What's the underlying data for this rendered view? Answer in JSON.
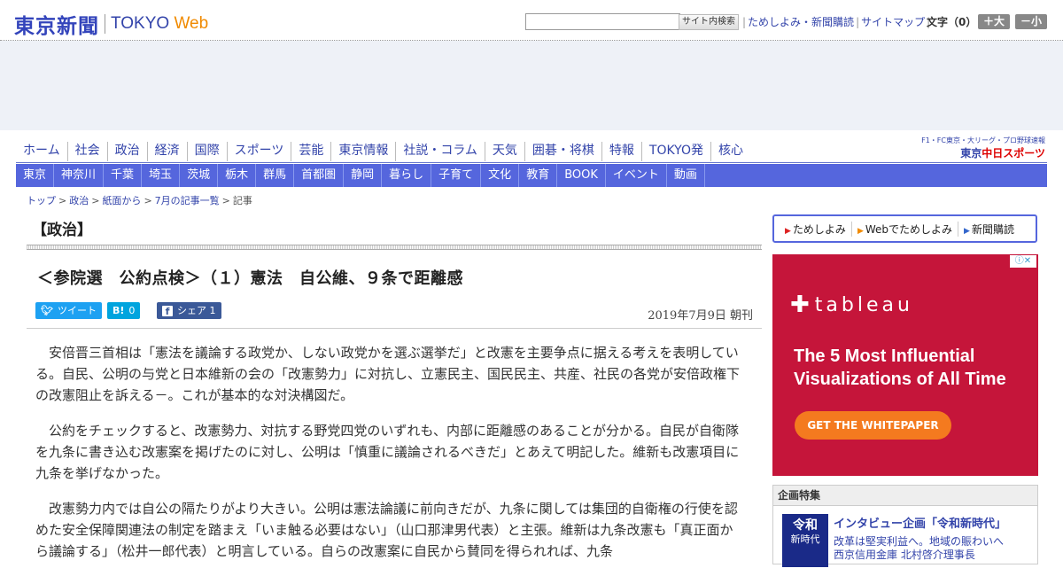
{
  "header": {
    "logo_jp": "東京新聞",
    "logo_en_tokyo": "TOKYO",
    "logo_en_web": "Web",
    "search_button": "サイト内検索",
    "links": [
      "ためしよみ・新聞購読",
      "サイトマップ"
    ],
    "font_size_label": "文字（0）",
    "font_larger": "＋大",
    "font_smaller": "－小"
  },
  "global_nav": [
    "ホーム",
    "社会",
    "政治",
    "経済",
    "国際",
    "スポーツ",
    "芸能",
    "東京情報",
    "社説・コラム",
    "天気",
    "囲碁・将棋",
    "特報",
    "TOKYO発",
    "核心"
  ],
  "chunichi": {
    "small": "F1・FC東京・大リーグ・プロ野球速報",
    "prefix": "東京",
    "name": "中日スポーツ"
  },
  "sub_nav": [
    "東京",
    "神奈川",
    "千葉",
    "埼玉",
    "茨城",
    "栃木",
    "群馬",
    "首都圏",
    "静岡",
    "暮らし",
    "子育て",
    "文化",
    "教育",
    "BOOK",
    "イベント",
    "動画"
  ],
  "breadcrumb": [
    "トップ",
    "政治",
    "紙面から",
    "7月の記事一覧",
    "記事"
  ],
  "article": {
    "category": "【政治】",
    "title": "＜参院選　公約点検＞（１）憲法　自公維、９条で距離感",
    "date": "2019年7月9日 朝刊",
    "share": {
      "tweet": "ツイート",
      "hatena_icon": "B!",
      "hatena_count": "0",
      "fb_icon": "f",
      "fb_label": "シェア",
      "fb_count": "1"
    },
    "paragraphs": [
      "安倍晋三首相は「憲法を議論する政党か、しない政党かを選ぶ選挙だ」と改憲を主要争点に据える考えを表明している。自民、公明の与党と日本維新の会の「改憲勢力」に対抗し、立憲民主、国民民主、共産、社民の各党が安倍政権下の改憲阻止を訴える－。これが基本的な対決構図だ。",
      "公約をチェックすると、改憲勢力、対抗する野党四党のいずれも、内部に距離感のあることが分かる。自民が自衛隊を九条に書き込む改憲案を掲げたのに対し、公明は「慎重に議論されるべきだ」とあえて明記した。維新も改憲項目に九条を挙げなかった。",
      "改憲勢力内では自公の隔たりがより大きい。公明は憲法論議に前向きだが、九条に関しては集団的自衛権の行使を認めた安全保障関連法の制定を踏まえ「いま触る必要はない」（山口那津男代表）と主張。維新は九条改憲も「真正面から議論する」（松井一郎代表）と明言している。自らの改憲案に自民から賛同を得られれば、九条"
    ]
  },
  "sidebar": {
    "links": [
      "ためしよみ",
      "Webでためしよみ",
      "新聞購読"
    ],
    "ad": {
      "brand": "tableau",
      "title": "The 5 Most Influential Visualizations of All Time",
      "cta": "GET THE WHITEPAPER"
    },
    "feature": {
      "heading": "企画特集",
      "thumb_line1": "令和",
      "thumb_line2": "新時代",
      "title": "インタビュー企画「令和新時代」",
      "sub1": "改革は堅実利益へ。地域の賑わいへ",
      "sub2": "西京信用金庫 北村啓介理事長"
    }
  },
  "colors": {
    "brand_blue": "#3344aa",
    "nav_bar": "#5566dd",
    "ad_bg": "#c5153a",
    "ad_cta": "#f47a1f",
    "twitter": "#1da1f2",
    "hatena": "#00a4de",
    "facebook": "#3b5998"
  }
}
